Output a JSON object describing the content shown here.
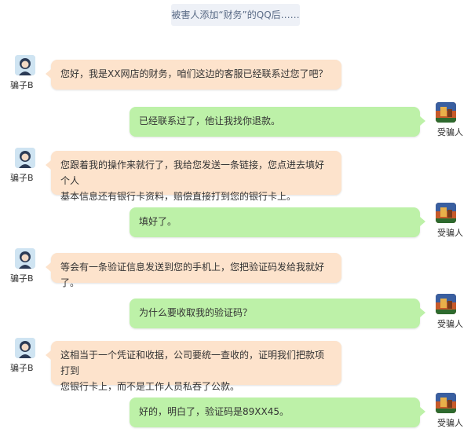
{
  "banner": "被害人添加“财务”的QQ后……",
  "colors": {
    "scammer_bubble": "#fde3cc",
    "victim_bubble": "#bdf1a8",
    "banner_bg": "#eef1f7"
  },
  "messages": [
    {
      "sender": "骗子B",
      "side": "left",
      "lines": [
        "您好，我是XX网店的财务，咱们这边的客服已经联系过您了吧？"
      ]
    },
    {
      "sender": "受骗人",
      "side": "right",
      "lines": [
        "已经联系过了，他让我找你退款。"
      ]
    },
    {
      "sender": "骗子B",
      "side": "left",
      "lines": [
        "您跟着我的操作来就行了，我给您发送一条链接，您点进去填好个人",
        "基本信息还有银行卡资料，赔偿直接打到您的银行卡上。"
      ]
    },
    {
      "sender": "受骗人",
      "side": "right",
      "lines": [
        "填好了。"
      ]
    },
    {
      "sender": "骗子B",
      "side": "left",
      "lines": [
        "等会有一条验证信息发送到您的手机上，您把验证码发给我就好了。"
      ]
    },
    {
      "sender": "受骗人",
      "side": "right",
      "lines": [
        "为什么要收取我的验证码？"
      ]
    },
    {
      "sender": "骗子B",
      "side": "left",
      "lines": [
        "这相当于一个凭证和收据，公司要统一查收的，证明我们把款项打到",
        "您银行卡上，而不是工作人员私吞了公款。"
      ]
    },
    {
      "sender": "受骗人",
      "side": "right",
      "lines": [
        "好的，明白了，验证码是89XX45。"
      ]
    }
  ]
}
